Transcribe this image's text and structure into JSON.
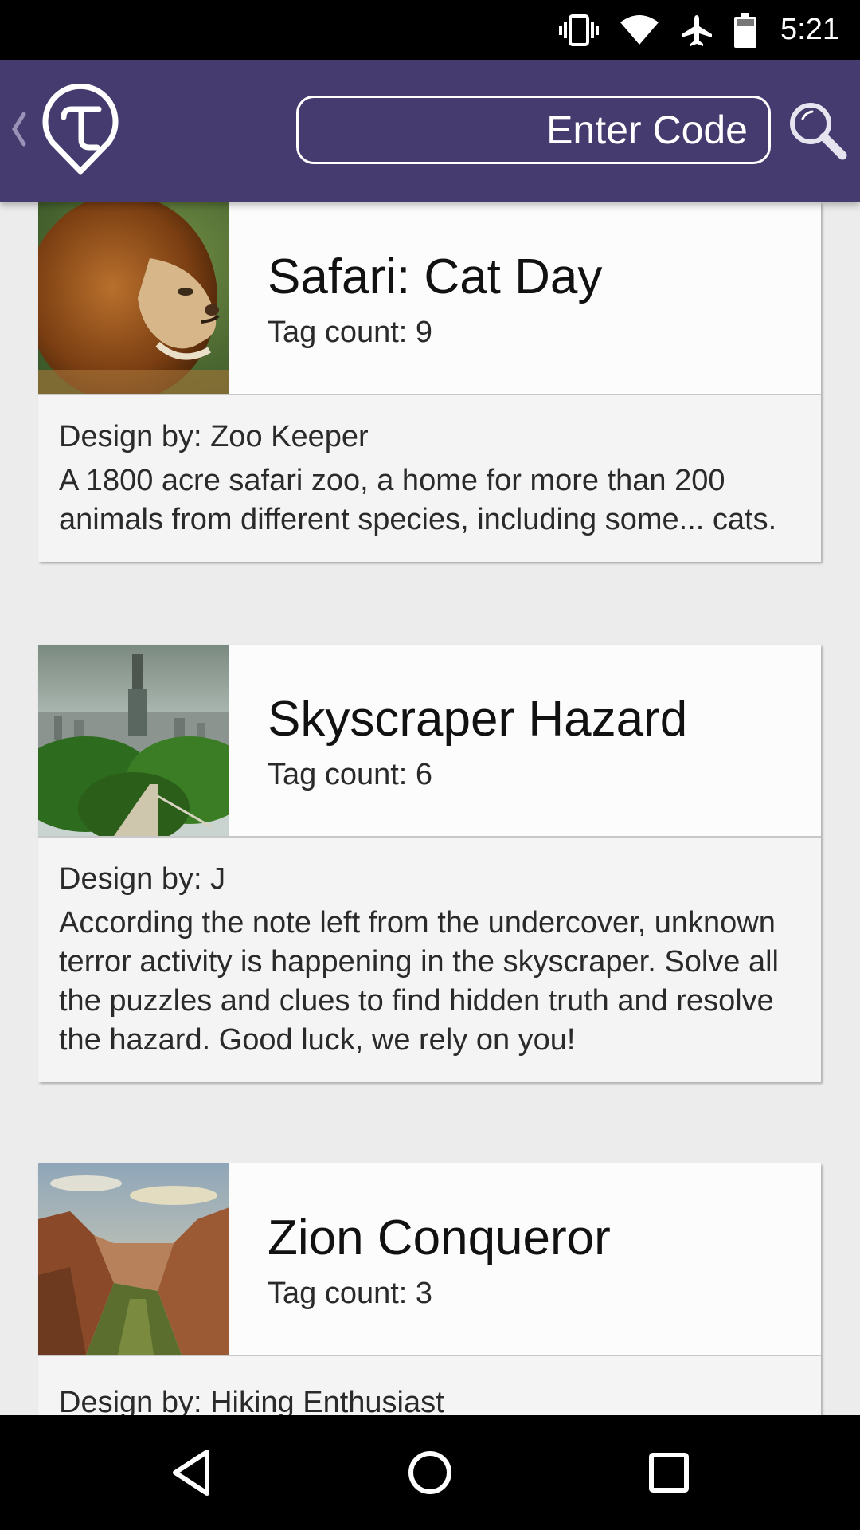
{
  "status_bar": {
    "time": "5:21",
    "icons": [
      "vibrate-icon",
      "wifi-icon",
      "airplane-mode-icon",
      "battery-icon"
    ]
  },
  "app_bar": {
    "back_icon": "chevron-left-icon",
    "logo_icon": "app-logo-pin-t",
    "search": {
      "placeholder": "Enter Code",
      "value": ""
    },
    "search_icon": "magnifier-icon",
    "background_color": "#463b6f"
  },
  "cards": [
    {
      "title": "Safari: Cat Day",
      "tag_count": "Tag count: 9",
      "designer": "Design by: Zoo Keeper",
      "description": "A 1800 acre safari zoo, a home for more than 200 animals from different species, including some... cats.",
      "thumbnail": "lion"
    },
    {
      "title": "Skyscraper Hazard",
      "tag_count": "Tag count: 6",
      "designer": "Design by: J",
      "description": "According the note left from the undercover, unknown terror activity is happening in the skyscraper. Solve all the puzzles and clues to find hidden truth and resolve the hazard. Good luck, we rely on you!",
      "thumbnail": "city-skyline"
    },
    {
      "title": "Zion Conqueror",
      "tag_count": "Tag count: 3",
      "designer": "Design by: Hiking Enthusiast",
      "description": "",
      "thumbnail": "canyon"
    }
  ],
  "nav_bar": {
    "back": "triangle-back-icon",
    "home": "circle-home-icon",
    "recents": "square-recents-icon"
  }
}
